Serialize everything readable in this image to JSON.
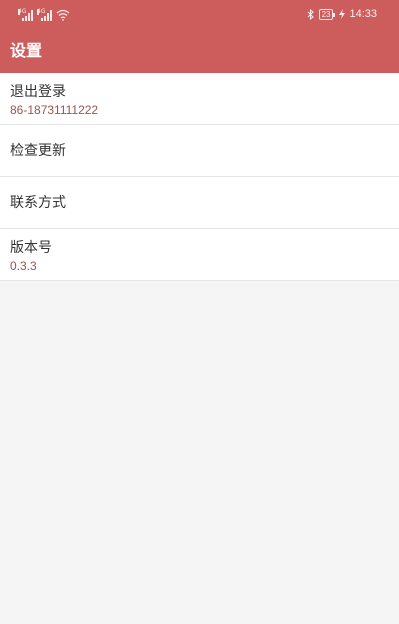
{
  "status_bar": {
    "time": "14:33",
    "battery": "23",
    "network_1": "4G",
    "network_2": "4G",
    "icons": [
      "signal-icon",
      "signal-icon",
      "wifi-icon",
      "bluetooth-icon",
      "battery-icon",
      "charging-icon"
    ]
  },
  "header": {
    "title": "设置"
  },
  "settings": {
    "items": [
      {
        "label": "退出登录",
        "sub": "86-18731111222"
      },
      {
        "label": "检查更新"
      },
      {
        "label": "联系方式"
      },
      {
        "label": "版本号",
        "sub": "0.3.3"
      }
    ]
  },
  "colors": {
    "appbar": "#cd5c5c",
    "subtext": "#a0524a",
    "background": "#f5f5f5"
  }
}
